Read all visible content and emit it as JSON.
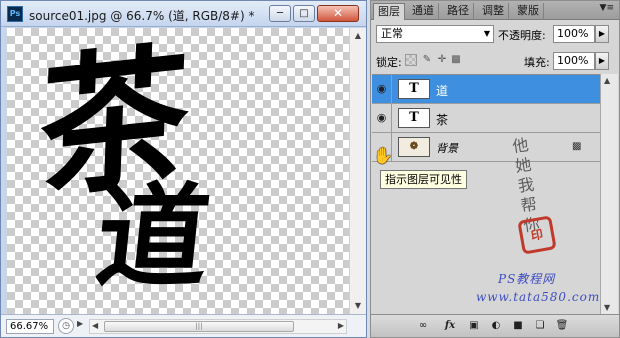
{
  "document": {
    "app_icon_text": "Ps",
    "title": "source01.jpg @ 66.7% (道, RGB/8#) *",
    "canvas_text_1": "茶",
    "canvas_text_2": "道",
    "zoom": "66.67%"
  },
  "layers_panel": {
    "tabs": [
      {
        "label": "图层",
        "active": true
      },
      {
        "label": "通道",
        "active": false
      },
      {
        "label": "路径",
        "active": false
      },
      {
        "label": "调整",
        "active": false
      },
      {
        "label": "蒙版",
        "active": false
      }
    ],
    "blend_mode": "正常",
    "opacity_label": "不透明度:",
    "opacity_value": "100%",
    "lock_label": "锁定:",
    "fill_label": "填充:",
    "fill_value": "100%",
    "layers": [
      {
        "name": "道",
        "thumb": "T",
        "visible": true,
        "selected": true
      },
      {
        "name": "茶",
        "thumb": "T",
        "visible": true,
        "selected": false
      },
      {
        "name": "背景",
        "thumb": "",
        "visible": false,
        "selected": false,
        "locked": true
      }
    ],
    "tooltip": "指示图层可见性"
  },
  "watermark": {
    "line1": "PS教程网",
    "line2": "www.tata580.com"
  },
  "colors": {
    "selected_layer": "#3f8fe0",
    "close_button": "#d0563b",
    "seal": "#c0392b",
    "watermark_text": "#3e4ec0"
  },
  "icons": [
    "ps-app-icon",
    "minimize-icon",
    "maximize-icon",
    "close-icon",
    "eye-icon",
    "lock-transparent-icon",
    "lock-brush-icon",
    "lock-move-icon",
    "lock-all-icon",
    "link-icon",
    "fx-icon",
    "mask-icon",
    "adjustment-icon",
    "group-icon",
    "new-layer-icon",
    "delete-icon",
    "hand-cursor-icon"
  ]
}
